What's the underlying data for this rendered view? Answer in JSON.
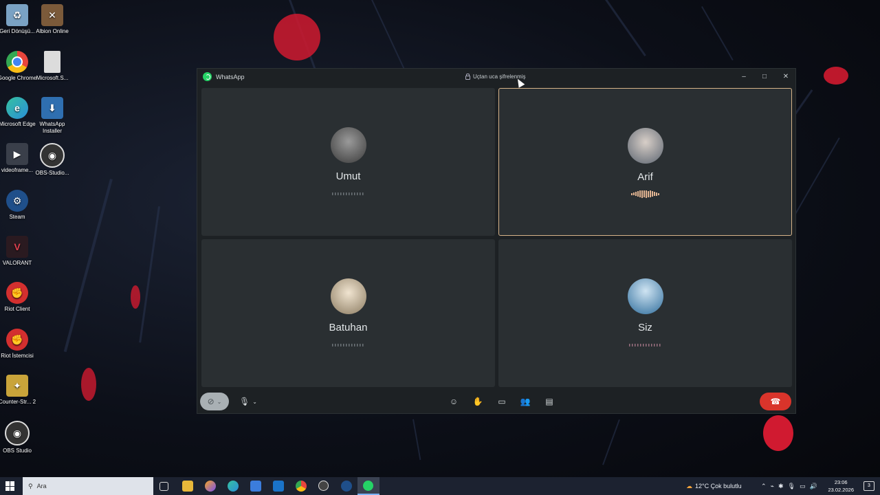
{
  "desktop": {
    "icons": [
      {
        "label": "Geri Dönüşü...",
        "icon": "recycle-bin-icon",
        "color": "#7aa2c4"
      },
      {
        "label": "Albion Online",
        "icon": "albion-icon",
        "color": "#7b5a3a"
      },
      {
        "label": "Google Chrome",
        "icon": "chrome-icon",
        "color": "#e8453c"
      },
      {
        "label": "Microsoft.S...",
        "icon": "file-icon",
        "color": "#dcdcdc"
      },
      {
        "label": "Microsoft Edge",
        "icon": "edge-icon",
        "color": "#2a8fd8"
      },
      {
        "label": "WhatsApp Installer",
        "icon": "installer-icon",
        "color": "#2f6fb0"
      },
      {
        "label": "videoframe...",
        "icon": "video-icon",
        "color": "#3a3f4a"
      },
      {
        "label": "OBS-Studio...",
        "icon": "obs-icon",
        "color": "#333"
      },
      {
        "label": "Steam",
        "icon": "steam-icon",
        "color": "#1f4f8a"
      },
      {
        "label": "VALORANT",
        "icon": "valorant-icon",
        "color": "#c53a4a"
      },
      {
        "label": "Riot Client",
        "icon": "riot-icon",
        "color": "#d32f2f"
      },
      {
        "label": "Riot İstemcisi",
        "icon": "riot-icon",
        "color": "#d32f2f"
      },
      {
        "label": "Counter-Str... 2",
        "icon": "cs2-icon",
        "color": "#c9a43a"
      },
      {
        "label": "OBS Studio",
        "icon": "obs-icon",
        "color": "#333"
      }
    ]
  },
  "window": {
    "app_title": "WhatsApp",
    "encryption_label": "Uçtan uca şifrelenmiş",
    "controls": {
      "minimize": "–",
      "maximize": "□",
      "close": "✕"
    }
  },
  "participants": [
    {
      "name": "Umut",
      "speaking": false,
      "avatar_color": "#4a4a4a"
    },
    {
      "name": "Arif",
      "speaking": true,
      "avatar_color": "#6b7480"
    },
    {
      "name": "Batuhan",
      "speaking": false,
      "avatar_color": "#c9b79a"
    },
    {
      "name": "Siz",
      "speaking": false,
      "avatar_color": "#4f8fc0"
    }
  ],
  "accent_speaking": "#d8b48a",
  "end_call_color": "#d9342b",
  "taskbar": {
    "search_placeholder": "Ara",
    "weather": "12°C  Çok bulutlu",
    "time": "23:06",
    "date": "23.02.2026",
    "notification_count": "3"
  }
}
